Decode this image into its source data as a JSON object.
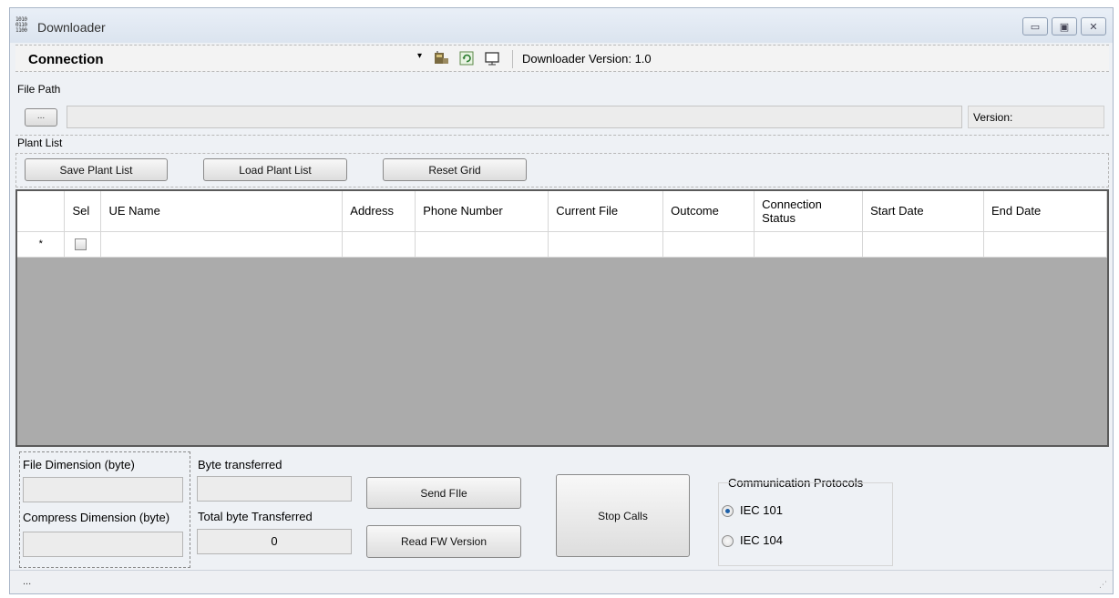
{
  "window": {
    "title": "Downloader"
  },
  "toolbar": {
    "connection_label": "Connection",
    "dropdown_glyph": "▾",
    "version_text": "Downloader Version: 1.0",
    "icons": [
      "modem-icon",
      "refresh-icon",
      "monitor-icon"
    ]
  },
  "file_path": {
    "group_label": "File Path",
    "browse_label": "...",
    "path_value": "",
    "version_label": "Version:"
  },
  "plant_list": {
    "group_label": "Plant List",
    "save_label": "Save Plant List",
    "load_label": "Load Plant List",
    "reset_label": "Reset Grid"
  },
  "grid": {
    "columns": [
      "",
      "Sel",
      "UE Name",
      "Address",
      "Phone Number",
      "Current File",
      "Outcome",
      "Connection Status",
      "Start Date",
      "End Date"
    ],
    "new_row_marker": "*"
  },
  "bottom": {
    "file_dimension_label": "File Dimension (byte)",
    "file_dimension_value": "",
    "compress_dimension_label": "Compress Dimension (byte)",
    "compress_dimension_value": "",
    "byte_transferred_label": "Byte transferred",
    "byte_transferred_value": "",
    "total_transferred_label": "Total byte Transferred",
    "total_transferred_value": "0",
    "send_file_label": "Send FIle",
    "read_fw_label": "Read FW Version",
    "stop_calls_label": "Stop Calls",
    "protocols_label": "Communication Protocols",
    "protocol_options": [
      "IEC 101",
      "IEC 104"
    ],
    "protocol_selected": "IEC 101"
  },
  "status": {
    "text": "..."
  }
}
